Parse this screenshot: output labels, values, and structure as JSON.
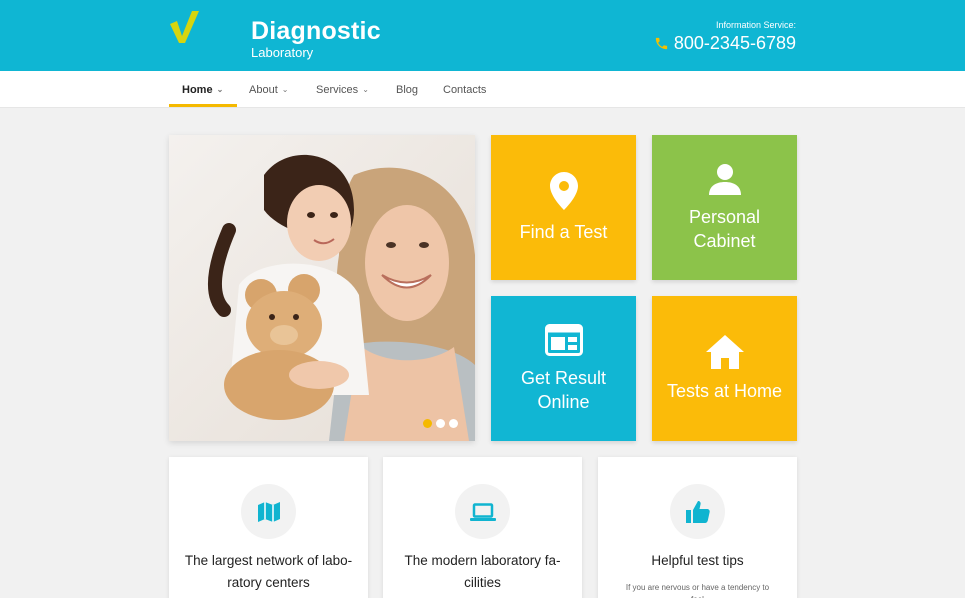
{
  "header": {
    "brand_title": "Diagnostic",
    "brand_subtitle": "Laboratory",
    "info_label": "Information Service:",
    "phone": "800-2345-6789",
    "accent_color": "#0fb6d3"
  },
  "nav": {
    "items": [
      {
        "label": "Home",
        "dropdown": true,
        "active": true
      },
      {
        "label": "About",
        "dropdown": true
      },
      {
        "label": "Services",
        "dropdown": true
      },
      {
        "label": "Blog",
        "dropdown": false
      },
      {
        "label": "Contacts",
        "dropdown": false
      }
    ]
  },
  "slider": {
    "dots": 3,
    "active_dot": 1
  },
  "tiles": [
    {
      "label": "Find a Test",
      "icon": "map-pin-icon",
      "color": "#fbbb09"
    },
    {
      "label": "Personal Cabinet",
      "icon": "user-icon",
      "color": "#8cc34a"
    },
    {
      "label": "Get Result Online",
      "icon": "browser-window-icon",
      "color": "#11b6d3"
    },
    {
      "label": "Tests at Home",
      "icon": "home-icon",
      "color": "#fbbb09"
    }
  ],
  "features": [
    {
      "title": "The largest network of labo-ratory centers",
      "icon": "map-icon"
    },
    {
      "title": "The modern laboratory fa-cilities",
      "icon": "laptop-icon"
    },
    {
      "title": "Helpful test tips",
      "icon": "thumbs-up-icon",
      "text": "If you are nervous or have a tendency to feel"
    }
  ]
}
